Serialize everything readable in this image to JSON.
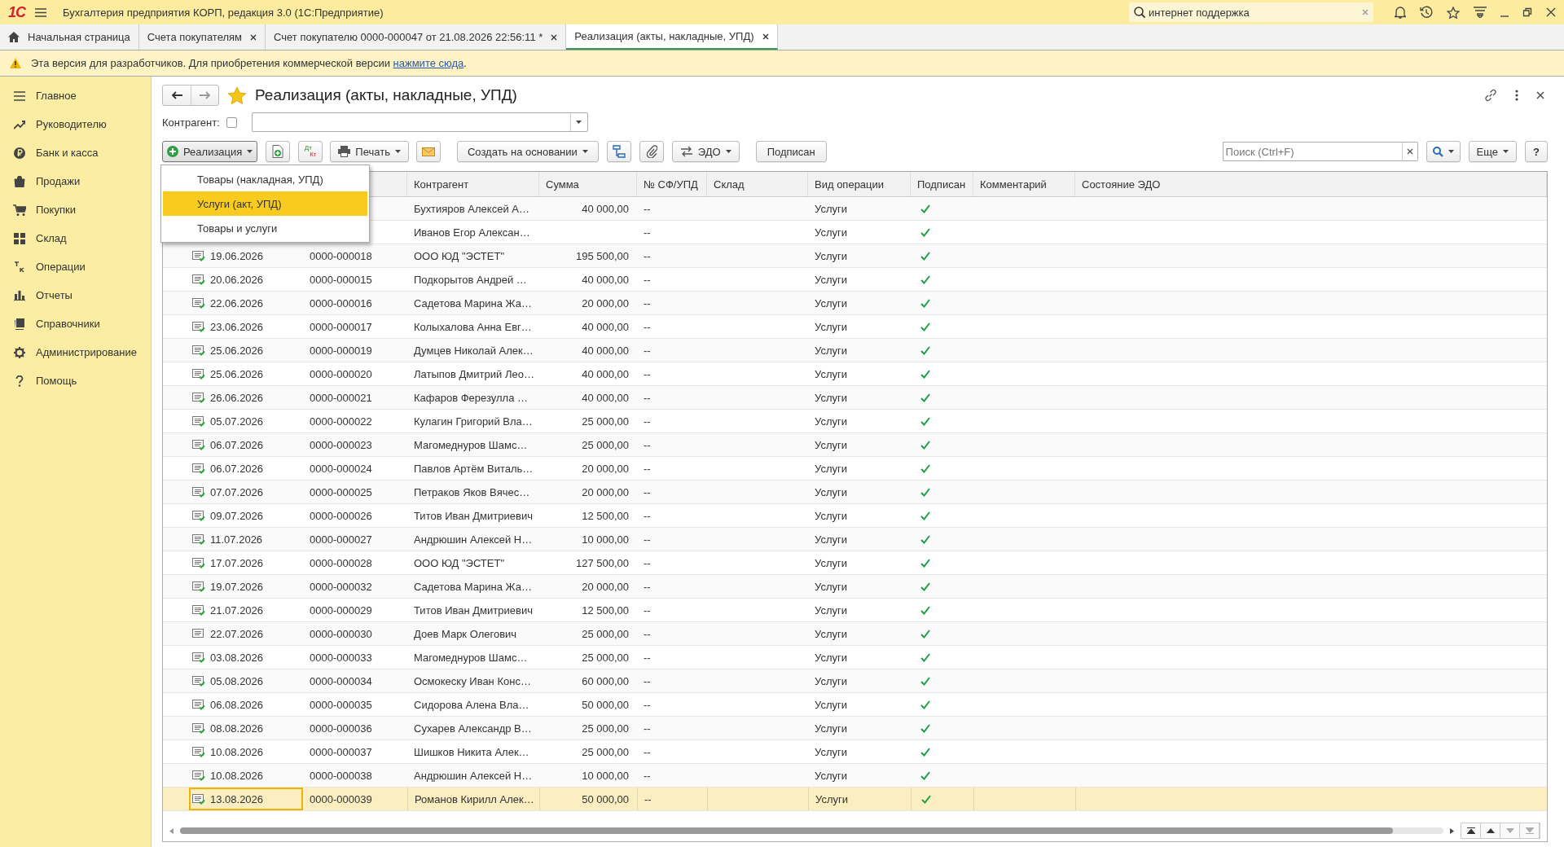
{
  "window": {
    "logo": "1С",
    "title": "Бухгалтерия предприятия КОРП, редакция 3.0  (1С:Предприятие)",
    "search": {
      "value": "интернет поддержка"
    }
  },
  "tabs": [
    {
      "label": "Начальная страница",
      "selected": false,
      "kind": "home"
    },
    {
      "label": "Счета покупателям",
      "selected": false,
      "kind": "doc"
    },
    {
      "label": "Счет покупателю 0000-000047 от 21.08.2026 22:56:11 *",
      "selected": false,
      "kind": "doc"
    },
    {
      "label": "Реализация (акты, накладные, УПД)",
      "selected": true,
      "kind": "doc"
    }
  ],
  "notice": {
    "text": "Эта версия для разработчиков. Для приобретения коммерческой версии ",
    "link": "нажмите сюда",
    "after": "."
  },
  "sidebar": {
    "items": [
      {
        "label": "Главное"
      },
      {
        "label": "Руководителю"
      },
      {
        "label": "Банк и касса"
      },
      {
        "label": "Продажи"
      },
      {
        "label": "Покупки"
      },
      {
        "label": "Склад"
      },
      {
        "label": "Операции"
      },
      {
        "label": "Отчеты"
      },
      {
        "label": "Справочники"
      },
      {
        "label": "Администрирование"
      },
      {
        "label": "Помощь"
      }
    ]
  },
  "form": {
    "title": "Реализация (акты, накладные, УПД)",
    "filter": {
      "label": "Контрагент:",
      "checked": false
    },
    "toolbar": {
      "create": "Реализация",
      "dt": "Дт",
      "kt": "Кт",
      "print": "Печать",
      "based_on": "Создать на основании",
      "edo": "ЭДО",
      "signed": "Подписан",
      "search_placeholder": "Поиск (Ctrl+F)",
      "more": "Еще",
      "help": "?"
    },
    "menu": [
      {
        "label": "Товары (накладная, УПД)",
        "selected": false
      },
      {
        "label": "Услуги (акт, УПД)",
        "selected": true
      },
      {
        "label": "Товары и услуги",
        "selected": false
      }
    ],
    "columns": [
      "Контрагент",
      "Сумма",
      "№ СФ/УПД",
      "Склад",
      "Вид операции",
      "Подписан",
      "Комментарий",
      "Состояние ЭДО"
    ],
    "rows": [
      {
        "counterparty": "Бухтияров Алексей А…",
        "sum": "40 000,00",
        "invoice": "--",
        "operation": "Услуги",
        "signed": true,
        "selected": false
      },
      {
        "counterparty": "Иванов Егор Алексан…",
        "invoice": "--",
        "operation": "Услуги",
        "signed": true,
        "selected": false
      },
      {
        "posted": true,
        "date": "19.06.2026",
        "number": "0000-000018",
        "counterparty": "ООО ЮД \"ЭСТЕТ\"",
        "sum": "195 500,00",
        "invoice": "--",
        "operation": "Услуги",
        "signed": true,
        "selected": false
      },
      {
        "posted": true,
        "date": "20.06.2026",
        "number": "0000-000015",
        "counterparty": "Подкорытов Андрей …",
        "sum": "40 000,00",
        "invoice": "--",
        "operation": "Услуги",
        "signed": true,
        "selected": false
      },
      {
        "posted": true,
        "date": "22.06.2026",
        "number": "0000-000016",
        "counterparty": "Садетова Марина Жа…",
        "sum": "20 000,00",
        "invoice": "--",
        "operation": "Услуги",
        "signed": true,
        "selected": false
      },
      {
        "posted": true,
        "date": "23.06.2026",
        "number": "0000-000017",
        "counterparty": "Колыхалова Анна Евг…",
        "sum": "40 000,00",
        "invoice": "--",
        "operation": "Услуги",
        "signed": true,
        "selected": false
      },
      {
        "posted": true,
        "date": "25.06.2026",
        "number": "0000-000019",
        "counterparty": "Думцев Николай Алек…",
        "sum": "40 000,00",
        "invoice": "--",
        "operation": "Услуги",
        "signed": true,
        "selected": false
      },
      {
        "posted": true,
        "date": "25.06.2026",
        "number": "0000-000020",
        "counterparty": "Латыпов Дмитрий Лео…",
        "sum": "40 000,00",
        "invoice": "--",
        "operation": "Услуги",
        "signed": true,
        "selected": false
      },
      {
        "posted": true,
        "date": "26.06.2026",
        "number": "0000-000021",
        "counterparty": "Кафаров Ферезулла …",
        "sum": "40 000,00",
        "invoice": "--",
        "operation": "Услуги",
        "signed": true,
        "selected": false
      },
      {
        "posted": true,
        "date": "05.07.2026",
        "number": "0000-000022",
        "counterparty": "Кулагин Григорий Вла…",
        "sum": "25 000,00",
        "invoice": "--",
        "operation": "Услуги",
        "signed": true,
        "selected": false
      },
      {
        "posted": true,
        "date": "06.07.2026",
        "number": "0000-000023",
        "counterparty": "Магомеднуров Шамс…",
        "sum": "25 000,00",
        "invoice": "--",
        "operation": "Услуги",
        "signed": true,
        "selected": false
      },
      {
        "posted": true,
        "date": "06.07.2026",
        "number": "0000-000024",
        "counterparty": "Павлов Артём Виталь…",
        "sum": "20 000,00",
        "invoice": "--",
        "operation": "Услуги",
        "signed": true,
        "selected": false
      },
      {
        "posted": true,
        "date": "07.07.2026",
        "number": "0000-000025",
        "counterparty": "Петраков Яков Вячес…",
        "sum": "20 000,00",
        "invoice": "--",
        "operation": "Услуги",
        "signed": true,
        "selected": false
      },
      {
        "posted": true,
        "date": "09.07.2026",
        "number": "0000-000026",
        "counterparty": "Титов Иван Дмитриевич",
        "sum": "12 500,00",
        "invoice": "--",
        "operation": "Услуги",
        "signed": true,
        "selected": false
      },
      {
        "posted": true,
        "date": "11.07.2026",
        "number": "0000-000027",
        "counterparty": "Андрюшин Алексей Н…",
        "sum": "10 000,00",
        "invoice": "--",
        "operation": "Услуги",
        "signed": true,
        "selected": false
      },
      {
        "posted": true,
        "date": "17.07.2026",
        "number": "0000-000028",
        "counterparty": "ООО ЮД \"ЭСТЕТ\"",
        "sum": "127 500,00",
        "invoice": "--",
        "operation": "Услуги",
        "signed": true,
        "selected": false
      },
      {
        "posted": true,
        "date": "19.07.2026",
        "number": "0000-000032",
        "counterparty": "Садетова Марина Жа…",
        "sum": "20 000,00",
        "invoice": "--",
        "operation": "Услуги",
        "signed": true,
        "selected": false
      },
      {
        "posted": true,
        "date": "21.07.2026",
        "number": "0000-000029",
        "counterparty": "Титов Иван Дмитриевич",
        "sum": "12 500,00",
        "invoice": "--",
        "operation": "Услуги",
        "signed": true,
        "selected": false
      },
      {
        "posted": false,
        "date": "22.07.2026",
        "number": "0000-000030",
        "counterparty": "Доев Марк Олегович",
        "sum": "25 000,00",
        "invoice": "--",
        "operation": "Услуги",
        "signed": true,
        "selected": false
      },
      {
        "posted": true,
        "date": "03.08.2026",
        "number": "0000-000033",
        "counterparty": "Магомеднуров Шамс…",
        "sum": "25 000,00",
        "invoice": "--",
        "operation": "Услуги",
        "signed": true,
        "selected": false
      },
      {
        "posted": true,
        "date": "05.08.2026",
        "number": "0000-000034",
        "counterparty": "Осмокеску Иван Конс…",
        "sum": "60 000,00",
        "invoice": "--",
        "operation": "Услуги",
        "signed": true,
        "selected": false
      },
      {
        "posted": true,
        "date": "06.08.2026",
        "number": "0000-000035",
        "counterparty": "Сидорова Алена Вла…",
        "sum": "50 000,00",
        "invoice": "--",
        "operation": "Услуги",
        "signed": true,
        "selected": false
      },
      {
        "posted": true,
        "date": "08.08.2026",
        "number": "0000-000036",
        "counterparty": "Сухарев Александр В…",
        "sum": "25 000,00",
        "invoice": "--",
        "operation": "Услуги",
        "signed": true,
        "selected": false
      },
      {
        "posted": true,
        "date": "10.08.2026",
        "number": "0000-000037",
        "counterparty": "Шишков Никита Алек…",
        "sum": "25 000,00",
        "invoice": "--",
        "operation": "Услуги",
        "signed": true,
        "selected": false
      },
      {
        "posted": true,
        "date": "10.08.2026",
        "number": "0000-000038",
        "counterparty": "Андрюшин Алексей Н…",
        "sum": "10 000,00",
        "invoice": "--",
        "operation": "Услуги",
        "signed": true,
        "selected": false
      },
      {
        "posted": true,
        "date": "13.08.2026",
        "number": "0000-000039",
        "counterparty": "Романов Кирилл Алек…",
        "sum": "50 000,00",
        "invoice": "--",
        "operation": "Услуги",
        "signed": true,
        "selected": true
      }
    ]
  }
}
